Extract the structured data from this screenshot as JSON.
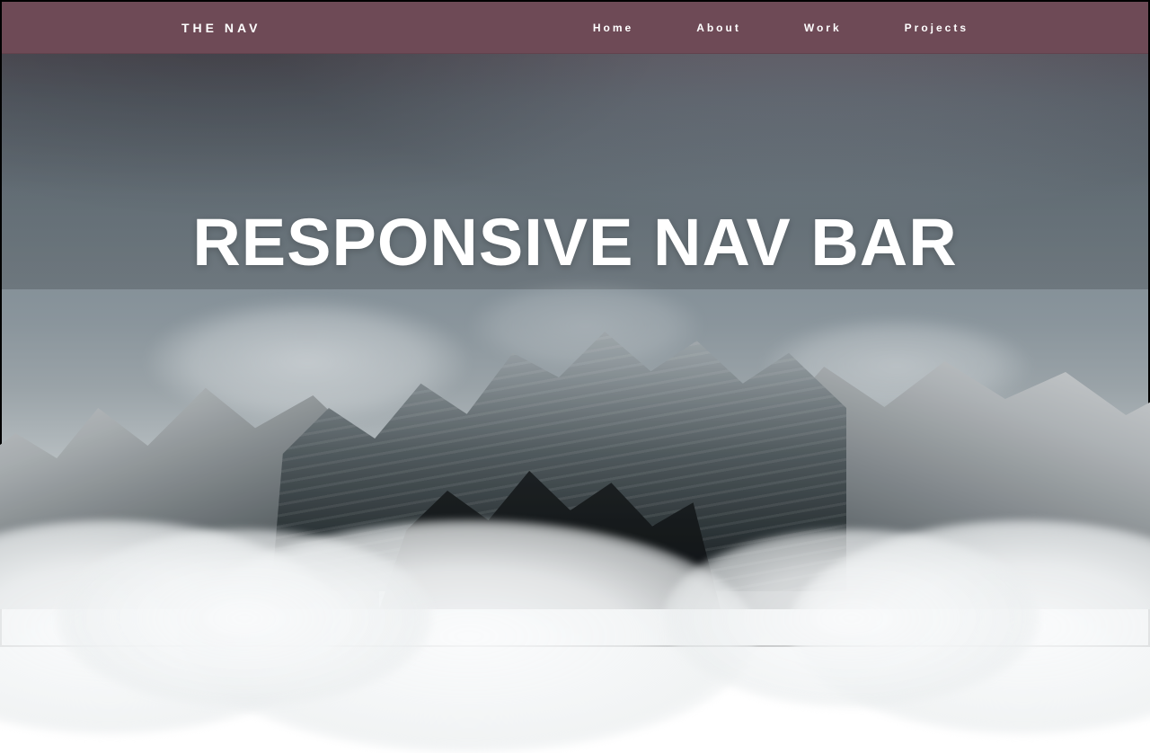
{
  "brand": "THE NAV",
  "nav": {
    "items": [
      {
        "label": "Home"
      },
      {
        "label": "About"
      },
      {
        "label": "Work"
      },
      {
        "label": "Projects"
      }
    ]
  },
  "hero": {
    "title": "RESPONSIVE NAV BAR"
  },
  "colors": {
    "navbar": "#6e4a56",
    "text": "#ffffff"
  }
}
